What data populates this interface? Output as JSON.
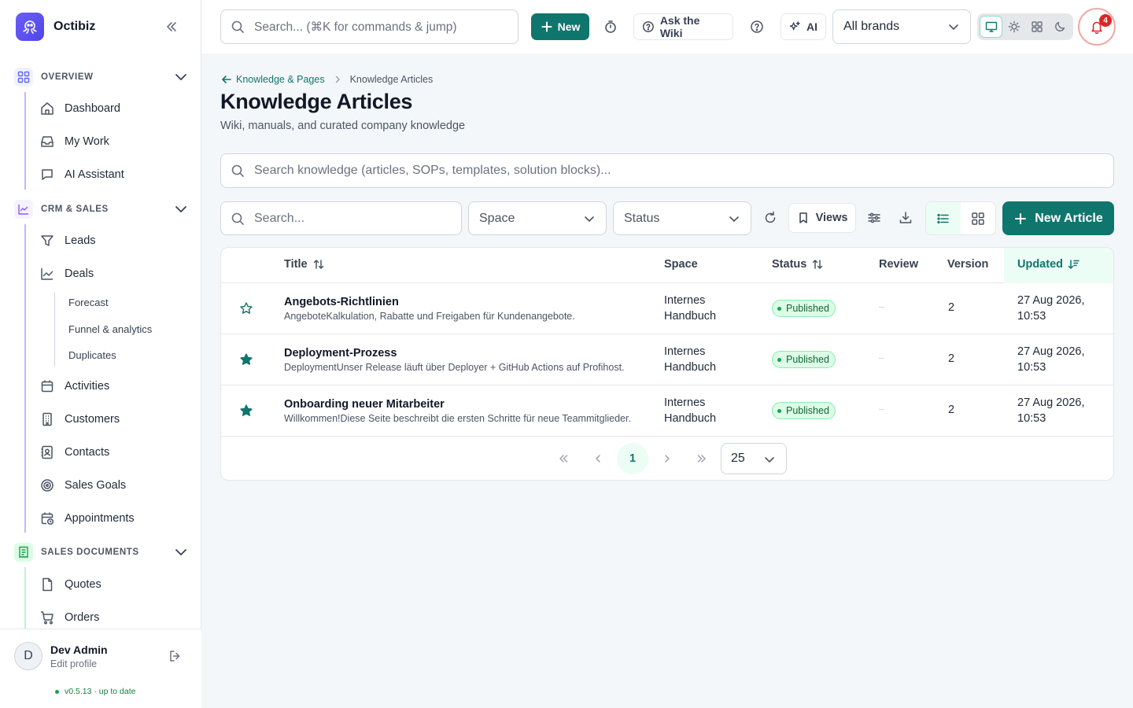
{
  "app": {
    "name": "Octibiz"
  },
  "sidebar": {
    "sections": [
      {
        "label": "OVERVIEW",
        "items": [
          "Dashboard",
          "My Work",
          "AI Assistant"
        ]
      },
      {
        "label": "CRM & SALES",
        "items": [
          "Leads",
          "Deals",
          "Activities",
          "Customers",
          "Contacts",
          "Sales Goals",
          "Appointments"
        ],
        "deal_subitems": [
          "Forecast",
          "Funnel & analytics",
          "Duplicates"
        ]
      },
      {
        "label": "SALES DOCUMENTS",
        "items": [
          "Quotes",
          "Orders"
        ]
      }
    ],
    "profile": {
      "initial": "D",
      "name": "Dev Admin",
      "sub": "Edit profile"
    },
    "version": "v0.5.13 · up to date"
  },
  "topbar": {
    "search_placeholder": "Search... (⌘K for commands & jump)",
    "new_label": "New",
    "ask_wiki_label": "Ask the Wiki",
    "ai_label": "AI",
    "brand_select": "All brands",
    "notifications_count": "4"
  },
  "page": {
    "breadcrumb": {
      "parent": "Knowledge & Pages",
      "current": "Knowledge Articles"
    },
    "title": "Knowledge Articles",
    "subtitle": "Wiki, manuals, and curated company knowledge",
    "kb_search_placeholder": "Search knowledge (articles, SOPs, templates, solution blocks)...",
    "filters": {
      "search_placeholder": "Search...",
      "space": "Space",
      "status": "Status",
      "views_label": "Views",
      "new_article_label": "New Article"
    }
  },
  "table": {
    "columns": {
      "title": "Title",
      "space": "Space",
      "status": "Status",
      "review": "Review",
      "version": "Version",
      "updated": "Updated"
    },
    "rows": [
      {
        "starred": false,
        "title": "Angebots-Richtlinien",
        "excerpt": "AngeboteKalkulation, Rabatte und Freigaben für Kundenangebote.",
        "space_line1": "Internes",
        "space_line2": "Handbuch",
        "status": "Published",
        "review": "–",
        "version": "2",
        "updated_line1": "27 Aug 2026,",
        "updated_line2": "10:53"
      },
      {
        "starred": true,
        "title": "Deployment-Prozess",
        "excerpt": "DeploymentUnser Release läuft über Deployer + GitHub Actions auf Profihost.",
        "space_line1": "Internes",
        "space_line2": "Handbuch",
        "status": "Published",
        "review": "–",
        "version": "2",
        "updated_line1": "27 Aug 2026,",
        "updated_line2": "10:53"
      },
      {
        "starred": true,
        "title": "Onboarding neuer Mitarbeiter",
        "excerpt": "Willkommen!Diese Seite beschreibt die ersten Schritte für neue Teammitglieder.",
        "space_line1": "Internes",
        "space_line2": "Handbuch",
        "status": "Published",
        "review": "–",
        "version": "2",
        "updated_line1": "27 Aug 2026,",
        "updated_line2": "10:53"
      }
    ],
    "pagination": {
      "current_page": "1",
      "page_size": "25"
    }
  },
  "colors": {
    "accent": "#0f766e",
    "brand": "#5b4fe9",
    "danger": "#dc2626",
    "success": "#16a34a"
  }
}
